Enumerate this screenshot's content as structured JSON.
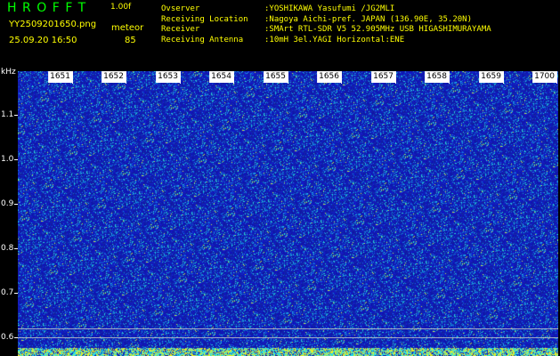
{
  "header": {
    "title": "HROFFT",
    "version": "1.00f",
    "filename": "YY2509201650.png",
    "datetime": "25.09.20 16:50",
    "meteor_label": "meteor",
    "meteor_count": "85"
  },
  "info": [
    {
      "key": "Ovserver",
      "value": ":YOSHIKAWA Yasufumi /JG2MLI"
    },
    {
      "key": "Receiving Location",
      "value": ":Nagoya Aichi-pref. JAPAN (136.90E, 35.20N)"
    },
    {
      "key": "Receiver",
      "value": ":SMArt RTL-SDR V5 52.905MHz USB HIGASHIMURAYAMA"
    },
    {
      "key": "Receiving Antenna",
      "value": ":10mH 3el.YAGI Horizontal:ENE"
    }
  ],
  "y_axis": {
    "unit": "kHz",
    "ticks": [
      "1.1",
      "1.0",
      "0.9",
      "0.8",
      "0.7",
      "0.6"
    ]
  },
  "x_axis": {
    "ticks": [
      "1651",
      "1652",
      "1653",
      "1654",
      "1655",
      "1656",
      "1657",
      "1658",
      "1659",
      "1700"
    ]
  },
  "colors": {
    "background": "#000000",
    "waterfall_base": "#1a1ab8",
    "label_green": "#00ff00",
    "label_yellow": "#ffff00"
  }
}
